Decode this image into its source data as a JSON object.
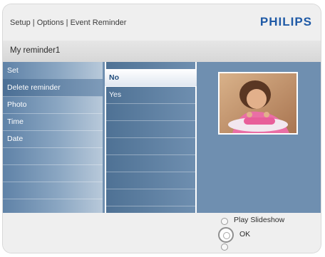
{
  "header": {
    "breadcrumb": "Setup | Options | Event Reminder",
    "brand": "PHILIPS"
  },
  "title": "My reminder1",
  "menu": {
    "items": [
      {
        "label": "Set"
      },
      {
        "label": "Delete reminder"
      },
      {
        "label": "Photo"
      },
      {
        "label": "Time"
      },
      {
        "label": "Date"
      }
    ]
  },
  "submenu": {
    "items": [
      {
        "label": "No",
        "selected": true
      },
      {
        "label": "Yes",
        "selected": false
      }
    ]
  },
  "footer": {
    "play_slideshow": "Play Slideshow",
    "ok": "OK"
  },
  "colors": {
    "brand": "#1f5aa6",
    "panel": "#6f8fb0"
  },
  "icons": {
    "photo_preview": "photo-thumbnail-icon",
    "radio": "radio-button-icon"
  }
}
